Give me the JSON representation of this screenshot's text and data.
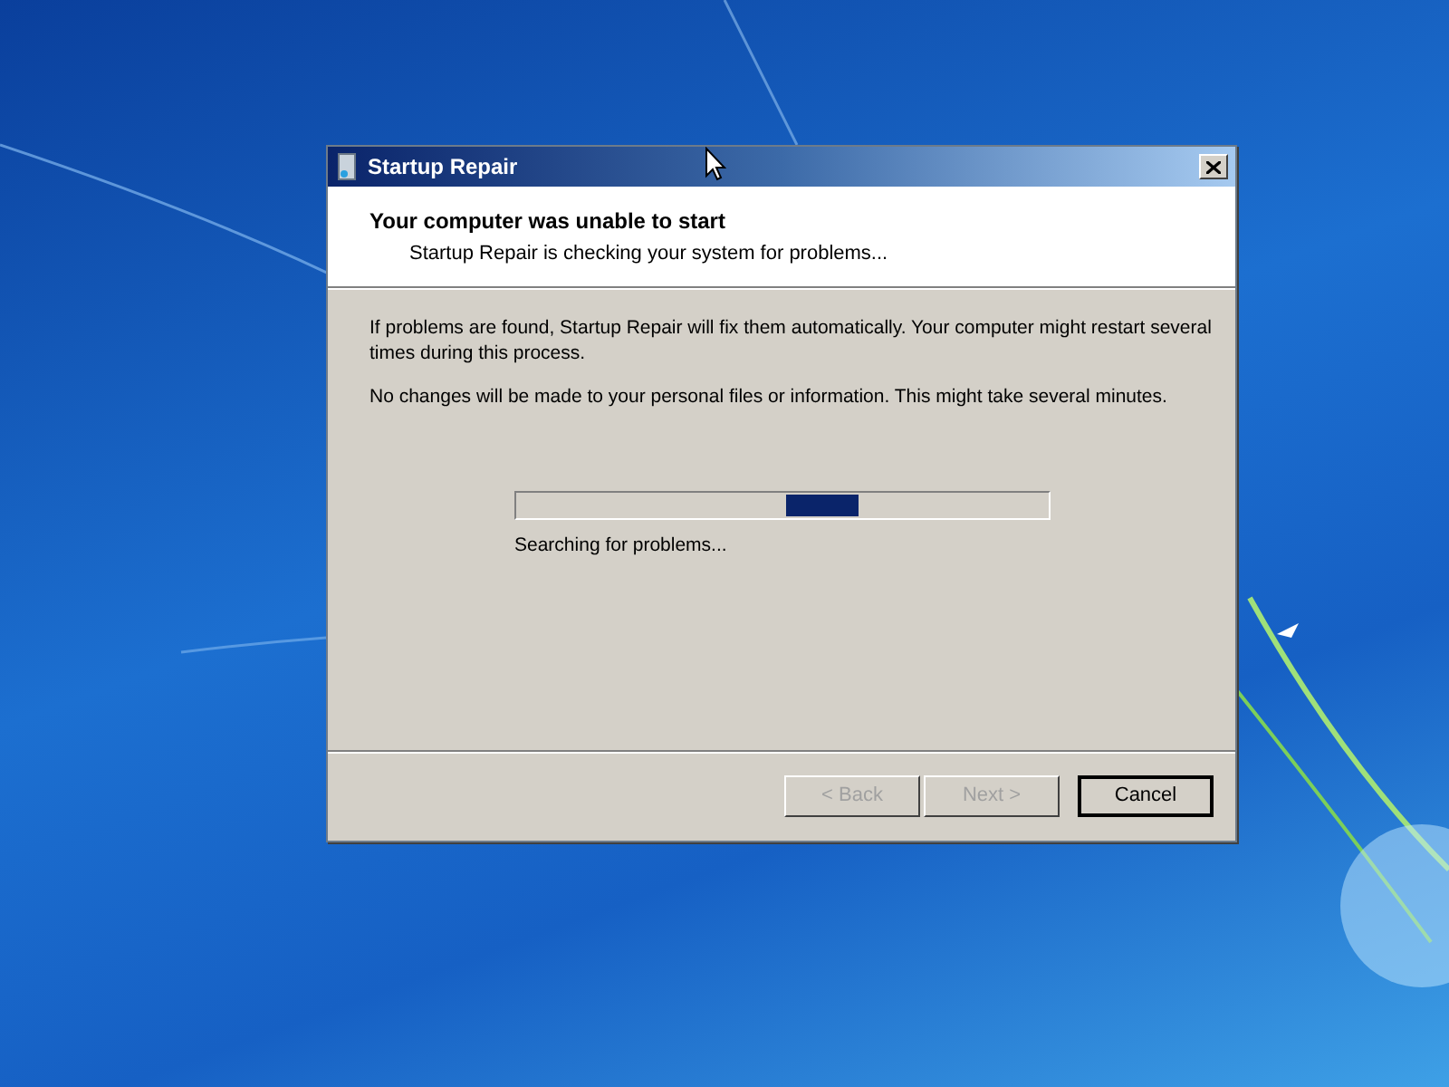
{
  "window": {
    "title": "Startup Repair"
  },
  "header": {
    "title": "Your computer was unable to start",
    "subtitle": "Startup Repair is checking your system for problems..."
  },
  "body": {
    "paragraphs": [
      "If problems are found, Startup Repair will fix them automatically. Your computer might restart several times during this process.",
      "No changes will be made to your personal files or information. This might take several minutes."
    ],
    "progress": {
      "kind": "marquee",
      "level": 0.575,
      "status": "Searching for problems..."
    }
  },
  "buttons": [
    {
      "label": "< Back",
      "disabled": true,
      "default": false
    },
    {
      "label": "Next >",
      "disabled": true,
      "default": false
    },
    {
      "label": "Cancel",
      "disabled": false,
      "default": true
    }
  ]
}
